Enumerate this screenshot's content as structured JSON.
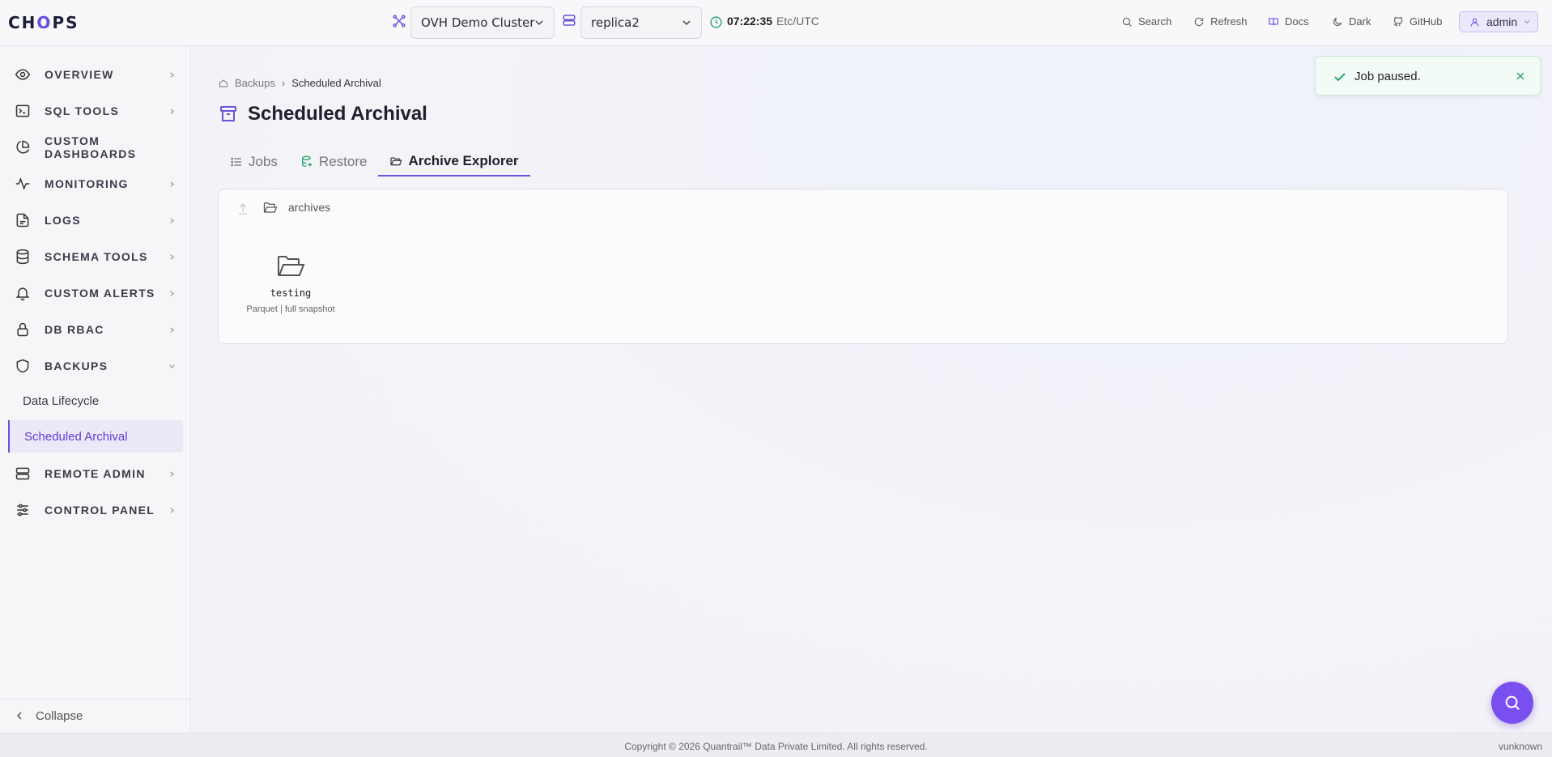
{
  "header": {
    "logo_prefix": "CH",
    "logo_o": "O",
    "logo_suffix": "PS",
    "cluster_select": "OVH Demo Cluster",
    "replica_select": "replica2",
    "time": "07:22:35",
    "timezone": "Etc/UTC",
    "search_label": "Search",
    "refresh_label": "Refresh",
    "docs_label": "Docs",
    "theme_label": "Dark",
    "github_label": "GitHub",
    "user_label": "admin",
    "accent_color": "#6b52d9"
  },
  "sidebar": {
    "items": [
      {
        "label": "OVERVIEW",
        "icon": "eye-icon"
      },
      {
        "label": "SQL TOOLS",
        "icon": "terminal-icon"
      },
      {
        "label": "CUSTOM DASHBOARDS",
        "icon": "pie-chart-icon"
      },
      {
        "label": "MONITORING",
        "icon": "activity-icon"
      },
      {
        "label": "LOGS",
        "icon": "file-text-icon"
      },
      {
        "label": "SCHEMA TOOLS",
        "icon": "database-icon"
      },
      {
        "label": "CUSTOM ALERTS",
        "icon": "bell-icon"
      },
      {
        "label": "DB RBAC",
        "icon": "lock-icon"
      },
      {
        "label": "BACKUPS",
        "icon": "shield-icon"
      },
      {
        "label": "REMOTE ADMIN",
        "icon": "server-icon"
      },
      {
        "label": "CONTROL PANEL",
        "icon": "sliders-icon"
      }
    ],
    "backups_sub": [
      "Data Lifecycle",
      "Scheduled Archival"
    ],
    "collapse_label": "Collapse"
  },
  "main": {
    "breadcrumb": [
      "Backups",
      "Scheduled Archival"
    ],
    "title": "Scheduled Archival",
    "tabs": [
      {
        "label": "Jobs",
        "active": false
      },
      {
        "label": "Restore",
        "active": false
      },
      {
        "label": "Archive Explorer",
        "active": true
      }
    ],
    "explorer": {
      "path": "archives",
      "entries": [
        {
          "name": "testing",
          "meta": "Parquet | full snapshot"
        }
      ]
    }
  },
  "toast": {
    "message": "Job paused.",
    "status": "success",
    "color": "#2fa66a"
  },
  "footer": {
    "copyright": "Copyright © 2026 Quantrail™ Data Private Limited. All rights reserved.",
    "version": "vunknown"
  }
}
